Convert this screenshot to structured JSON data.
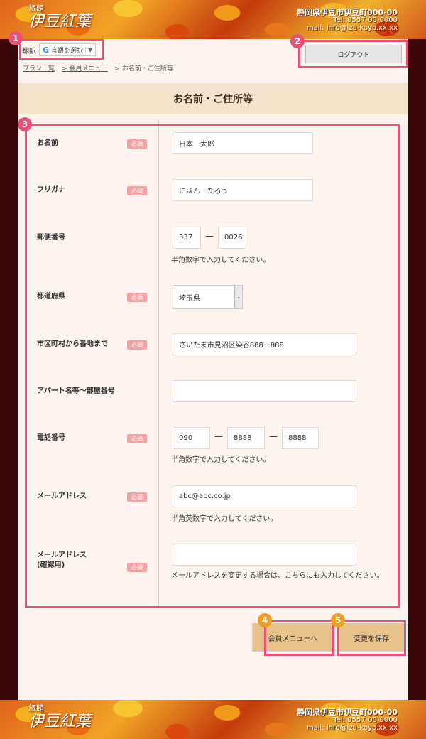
{
  "header": {
    "logo_small": "旅館",
    "logo_big": "伊豆紅葉",
    "address": "静岡県伊豆市伊豆町000-00",
    "tel": "Tel: 0557-00-0000",
    "mail": "mail: info@izu-koyo.xx.xx"
  },
  "translate": {
    "label": "翻訳",
    "select": "言語を選択"
  },
  "logout": "ログアウト",
  "breadcrumb": [
    "プラン一覧",
    "> 会員メニュー",
    "> お名前・ご住所等"
  ],
  "page_title": "お名前・ご住所等",
  "required": "必須",
  "fields": {
    "name": {
      "label": "お名前",
      "value": "日本　太郎"
    },
    "kana": {
      "label": "フリガナ",
      "value": "にほん　たろう"
    },
    "zip": {
      "label": "郵便番号",
      "value1": "337",
      "value2": "0026",
      "note": "半角数字で入力してください。"
    },
    "pref": {
      "label": "都道府県",
      "value": "埼玉県"
    },
    "city": {
      "label": "市区町村から番地まで",
      "value": "さいたま市見沼区染谷888－888"
    },
    "apt": {
      "label": "アパート名等～部屋番号",
      "value": ""
    },
    "phone": {
      "label": "電話番号",
      "value1": "090",
      "value2": "8888",
      "value3": "8888",
      "note": "半角数字で入力してください。"
    },
    "email": {
      "label": "メールアドレス",
      "value": "abc@abc.co.jp",
      "note": "半角英数字で入力してください。"
    },
    "email_confirm": {
      "label1": "メールアドレス",
      "label2": "(確認用)",
      "value": "",
      "note": "メールアドレスを変更する場合は、こちらにも入力してください。"
    }
  },
  "dash": "—",
  "buttons": {
    "member_menu": "会員メニューへ",
    "save": "変更を保存"
  },
  "markers": [
    "1",
    "2",
    "3",
    "4",
    "5"
  ],
  "colors": {
    "highlight": "#e8527a",
    "button": "#e9c18a",
    "title_bg": "#f3e4cc",
    "required_badge": "#f3a3a3"
  }
}
